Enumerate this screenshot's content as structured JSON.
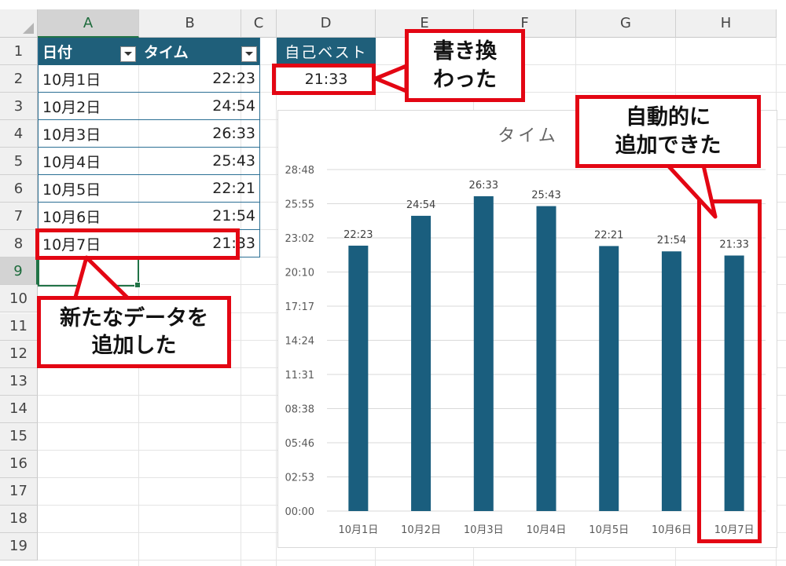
{
  "sheet": {
    "columns": [
      "A",
      "B",
      "C",
      "D",
      "E",
      "F",
      "G",
      "H"
    ],
    "rows": [
      "1",
      "2",
      "3",
      "4",
      "5",
      "6",
      "7",
      "8",
      "9",
      "10",
      "11",
      "12",
      "13",
      "14",
      "15",
      "16",
      "17",
      "18",
      "19"
    ],
    "selected_column": "A",
    "selected_row": "9"
  },
  "table": {
    "headers": [
      "日付",
      "タイム"
    ],
    "rows": [
      {
        "date": "10月1日",
        "time": "22:23"
      },
      {
        "date": "10月2日",
        "time": "24:54"
      },
      {
        "date": "10月3日",
        "time": "26:33"
      },
      {
        "date": "10月4日",
        "time": "25:43"
      },
      {
        "date": "10月5日",
        "time": "22:21"
      },
      {
        "date": "10月6日",
        "time": "21:54"
      },
      {
        "date": "10月7日",
        "time": "21:33"
      }
    ]
  },
  "best": {
    "label": "自己ベスト",
    "value": "21:33"
  },
  "callouts": {
    "new_data": [
      "新たなデータを",
      "追加した"
    ],
    "replaced": [
      "書き換",
      "わった"
    ],
    "auto_added": [
      "自動的に",
      "追加できた"
    ]
  },
  "chart_data": {
    "type": "bar",
    "title": "タイム",
    "categories": [
      "10月1日",
      "10月2日",
      "10月3日",
      "10月4日",
      "10月5日",
      "10月6日",
      "10月7日"
    ],
    "values": [
      22.383,
      24.9,
      26.55,
      25.717,
      22.35,
      21.9,
      21.55
    ],
    "data_labels": [
      "22:23",
      "24:54",
      "26:33",
      "25:43",
      "22:21",
      "21:54",
      "21:33"
    ],
    "ytick_labels": [
      "00:00",
      "02:53",
      "05:46",
      "08:38",
      "11:31",
      "14:24",
      "17:17",
      "20:10",
      "23:02",
      "25:55",
      "28:48"
    ],
    "ylim": [
      0,
      28.8
    ],
    "grid": true,
    "color": "#1a5e7e"
  }
}
